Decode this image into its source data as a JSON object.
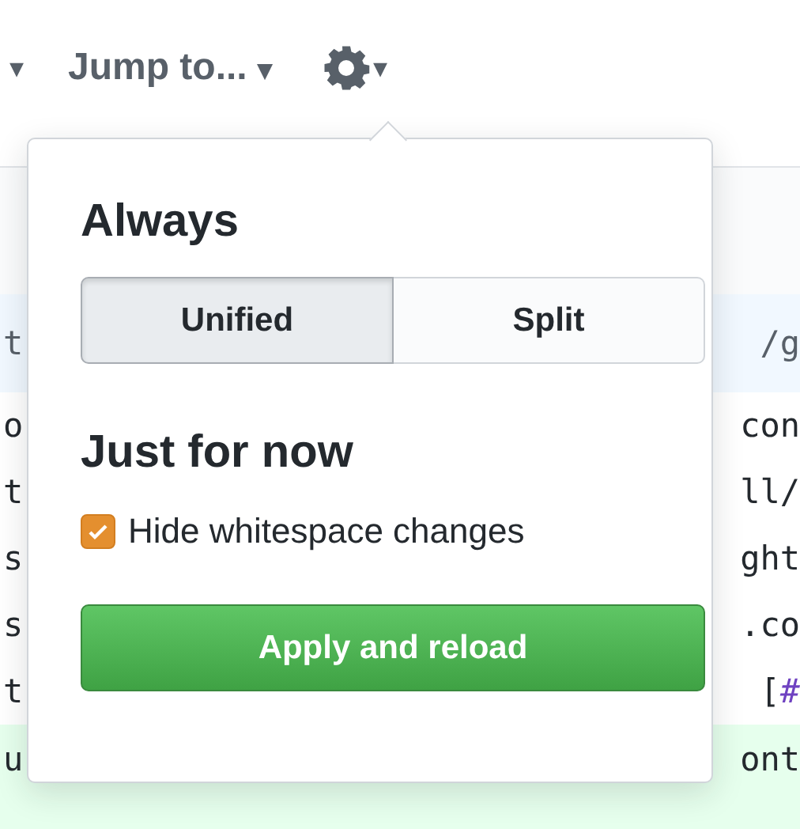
{
  "toolbar": {
    "file_filter_caret": "▾",
    "jump_to": {
      "label": "Jump to...",
      "caret": "▾"
    },
    "settings_caret": "▾"
  },
  "code_rows": [
    {
      "kind": "hunk",
      "left": "t",
      "right": "/g"
    },
    {
      "kind": "context",
      "left": "o",
      "right": "con"
    },
    {
      "kind": "context",
      "left": "t",
      "right": "ll/"
    },
    {
      "kind": "context",
      "left": "s",
      "right": "ght"
    },
    {
      "kind": "context",
      "left": "s",
      "right": ".co"
    },
    {
      "kind": "context",
      "left": "t",
      "right": "[",
      "right_link": "#"
    },
    {
      "kind": "added",
      "left": "u",
      "right": "ont"
    }
  ],
  "popover": {
    "always_heading": "Always",
    "view_modes": [
      {
        "label": "Unified",
        "selected": true
      },
      {
        "label": "Split",
        "selected": false
      }
    ],
    "now_heading": "Just for now",
    "hide_whitespace": {
      "label": "Hide whitespace changes",
      "checked": true
    },
    "apply_button": "Apply and reload"
  }
}
